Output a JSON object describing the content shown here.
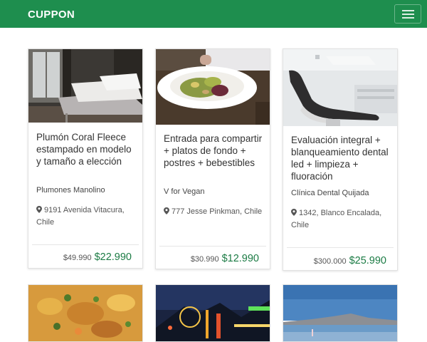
{
  "navbar": {
    "brand": "CUPPON",
    "menu_icon": "hamburger-menu-icon"
  },
  "deals": [
    {
      "title": "Plumón Coral Fleece estampado en modelo y tamaño a elección",
      "vendor": "Plumones Manolino",
      "address": "9191 Avenida Vitacura, Chile",
      "old_price": "$49.990",
      "new_price": "$22.990",
      "image": "bedroom-photo"
    },
    {
      "title": "Entrada para compartir + platos de fondo + postres + bebestibles",
      "vendor": "V for Vegan",
      "address": "777 Jesse Pinkman, Chile",
      "old_price": "$30.990",
      "new_price": "$12.990",
      "image": "salad-plate-photo"
    },
    {
      "title": "Evaluación integral + blanqueamiento dental led + limpieza + fluoración",
      "vendor": "Clínica Dental Quijada",
      "address": "1342, Blanco Encalada, Chile",
      "old_price": "$300.000",
      "new_price": "$25.990",
      "image": "dental-chair-photo"
    }
  ],
  "more_deals": [
    {
      "image": "stew-photo"
    },
    {
      "image": "carnival-night-photo"
    },
    {
      "image": "lake-mountain-photo"
    }
  ],
  "colors": {
    "navbar": "#1e8e4e",
    "price": "#1b7b44"
  }
}
